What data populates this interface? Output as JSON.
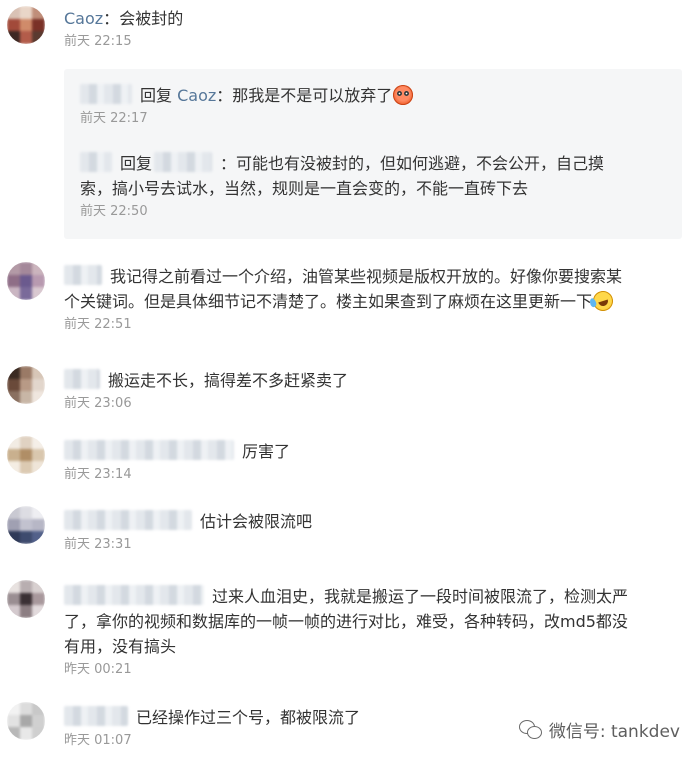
{
  "comments": [
    {
      "id": "c1",
      "username": "Caoz",
      "text": "会被封的",
      "time": "前天 22:15",
      "replies": [
        {
          "reply_word": "回复",
          "reply_to": "Caoz",
          "text": "那我是不是可以放弃了",
          "time": "前天 22:17",
          "emoji": "flushed-face-emoji"
        },
        {
          "reply_word": "回复",
          "text_line1": "可能也有没被封的，但如何逃避，不会公开，自己摸",
          "text_line2": "索，搞小号去试水，当然，规则是一直会变的，不能一直砖下去",
          "time": "前天 22:50"
        }
      ]
    },
    {
      "id": "c2",
      "text_line1": "我记得之前看过一个介绍，油管某些视频是版权开放的。好像你要搜索某",
      "text_line2": "个关键词。但是具体细节记不清楚了。楼主如果查到了麻烦在这里更新一下",
      "emoji": "rolling-laughing-emoji",
      "time": "前天 22:51"
    },
    {
      "id": "c3",
      "text": "搬运走不长，搞得差不多赶紧卖了",
      "time": "前天 23:06"
    },
    {
      "id": "c4",
      "text": "厉害了",
      "time": "前天 23:14"
    },
    {
      "id": "c5",
      "text": "估计会被限流吧",
      "time": "前天 23:31"
    },
    {
      "id": "c6",
      "text_line1": "过来人血泪史，我就是搬运了一段时间被限流了，检测太严",
      "text_line2": "了，拿你的视频和数据库的一帧一帧的进行对比，难受，各种转码，改md5都没",
      "text_line3": "有用，没有搞头",
      "time": "昨天 00:21"
    },
    {
      "id": "c7",
      "text": "已经操作过三个号，都被限流了",
      "time": "昨天 01:07"
    }
  ],
  "watermark": {
    "label": "微信号: tankdev",
    "icon": "wechat-icon"
  },
  "colors": {
    "username": "#567799",
    "text": "#333333",
    "time": "#999999",
    "reply_background": "#f5f6f7"
  }
}
